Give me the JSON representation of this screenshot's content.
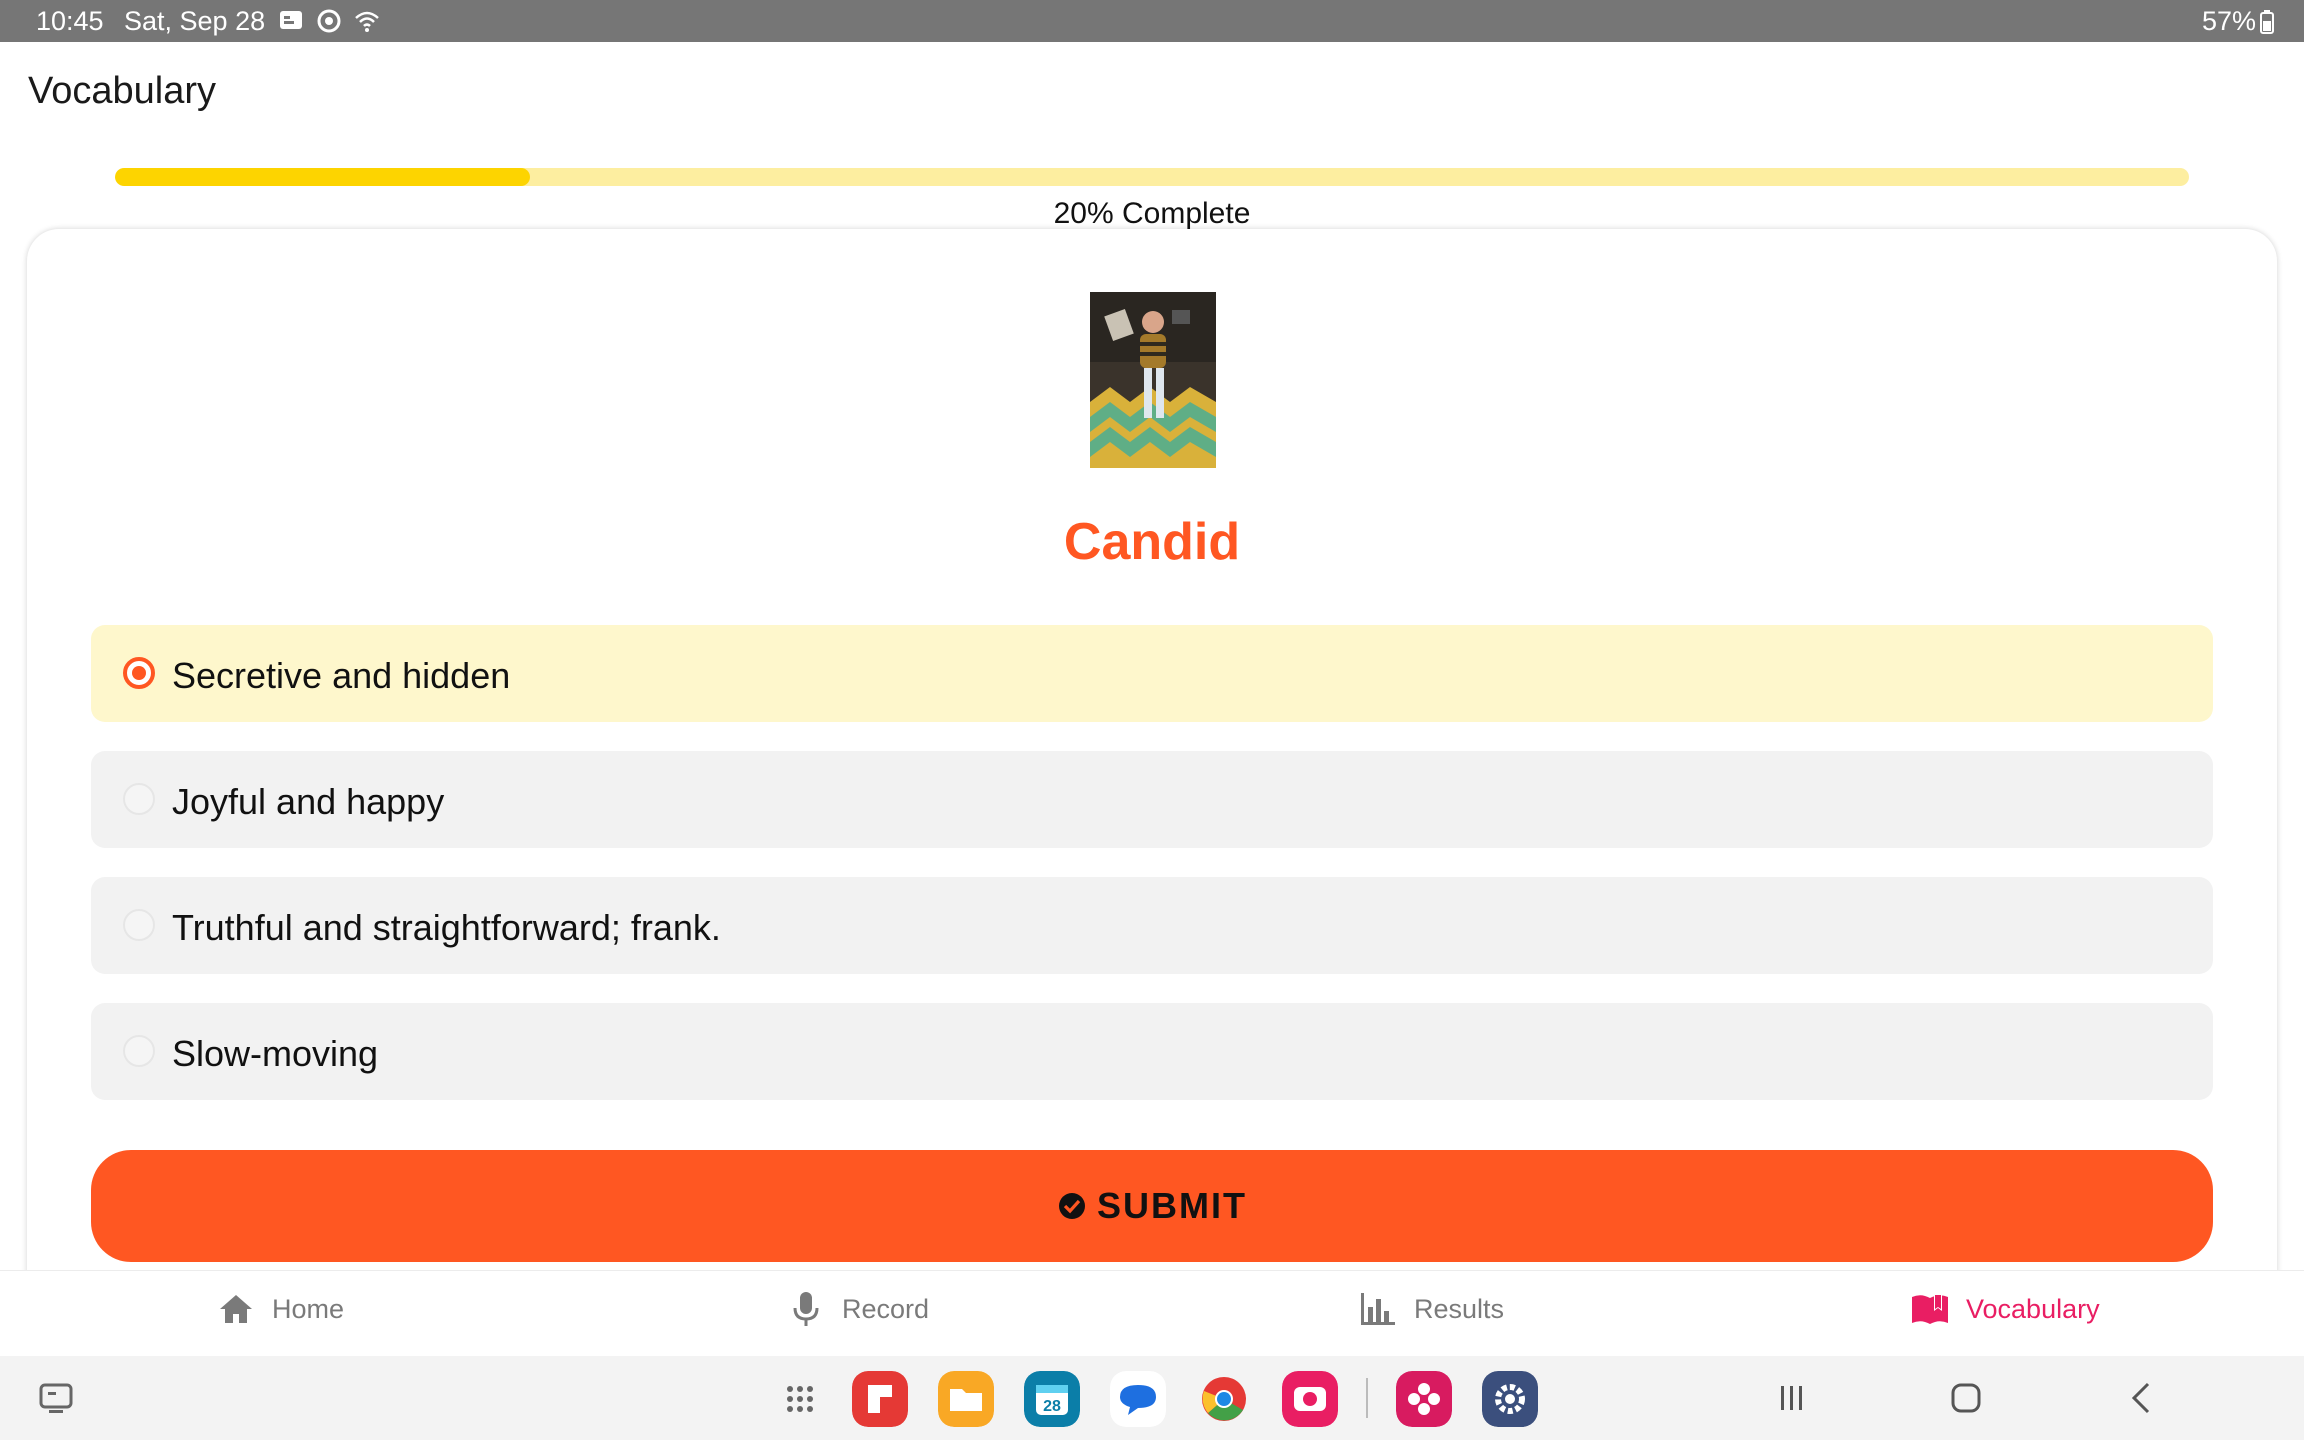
{
  "status_bar": {
    "time": "10:45",
    "date": "Sat, Sep 28",
    "battery": "57%",
    "icons": [
      "notification-icon",
      "sync-icon",
      "wifi-icon"
    ]
  },
  "header": {
    "title": "Vocabulary"
  },
  "progress": {
    "percent": 20,
    "label": "20% Complete",
    "fill_color": "#fdd400",
    "track_color": "#fdeea0"
  },
  "question": {
    "image_icon": "illustration-image",
    "word": "Candid",
    "word_color": "#ff5722",
    "options": [
      {
        "label": "Secretive and hidden",
        "selected": true
      },
      {
        "label": "Joyful and happy",
        "selected": false
      },
      {
        "label": "Truthful and straightforward; frank.",
        "selected": false
      },
      {
        "label": "Slow-moving",
        "selected": false
      }
    ]
  },
  "submit": {
    "label": "SUBMIT",
    "color": "#ff5722"
  },
  "bottom_nav": {
    "items": [
      {
        "label": "Home",
        "icon": "home-icon",
        "active": false
      },
      {
        "label": "Record",
        "icon": "microphone-icon",
        "active": false
      },
      {
        "label": "Results",
        "icon": "bar-chart-icon",
        "active": false
      },
      {
        "label": "Vocabulary",
        "icon": "book-icon",
        "active": true
      }
    ],
    "active_color": "#e91e63"
  },
  "dock": {
    "apps": [
      "app-drawer-icon",
      "flipboard-icon",
      "my-files-icon",
      "calendar-icon",
      "messages-icon",
      "chrome-icon",
      "screen-recorder-icon",
      "gallery-icon",
      "settings-icon"
    ],
    "calendar_day": "28"
  }
}
